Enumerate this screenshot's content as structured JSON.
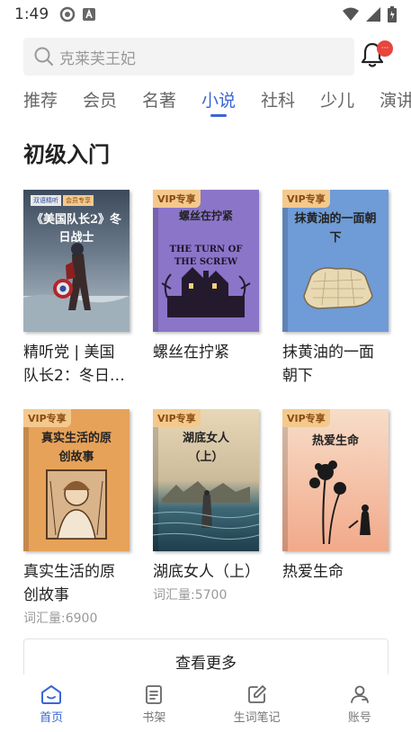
{
  "status_bar": {
    "time": "1:49"
  },
  "search": {
    "placeholder": "克莱芙王妃"
  },
  "notifications": {
    "badge": "···"
  },
  "tabs": [
    {
      "label": "推荐"
    },
    {
      "label": "会员"
    },
    {
      "label": "名著"
    },
    {
      "label": "小说"
    },
    {
      "label": "社科"
    },
    {
      "label": "少儿"
    },
    {
      "label": "演讲"
    }
  ],
  "active_tab": "小说",
  "section": {
    "title": "初级入门"
  },
  "books": [
    {
      "title": "精听党 | 美国队长2：冬日…",
      "vip": "",
      "cover_title": "《美国队长2》冬日战士",
      "cover_tag1": "双语精听",
      "cover_tag2": "会员专享",
      "meta": ""
    },
    {
      "title": "螺丝在拧紧",
      "vip": "VIP专享",
      "cover_title": "螺丝在拧紧",
      "cover_sub": "THE TURN OF THE SCREW",
      "meta": ""
    },
    {
      "title": "抹黄油的一面朝下",
      "vip": "VIP专享",
      "cover_title": "抹黄油的一面朝下",
      "meta": ""
    },
    {
      "title": "真实生活的原创故事",
      "vip": "VIP专享",
      "cover_title": "真实生活的原创故事",
      "meta": "词汇量:6900"
    },
    {
      "title": "湖底女人（上）",
      "vip": "VIP专享",
      "cover_title": "湖底女人（上）",
      "meta": "词汇量:5700"
    },
    {
      "title": "热爱生命",
      "vip": "VIP专享",
      "cover_title": "热爱生命",
      "meta": ""
    }
  ],
  "more_button": {
    "label": "查看更多"
  },
  "bottom_nav": [
    {
      "label": "首页",
      "icon": "home-icon"
    },
    {
      "label": "书架",
      "icon": "bookshelf-icon"
    },
    {
      "label": "生词笔记",
      "icon": "notes-icon"
    },
    {
      "label": "账号",
      "icon": "account-icon"
    }
  ],
  "colors": {
    "accent": "#3a66d6",
    "vip_bg": "#f3c98e",
    "badge": "#e8453c"
  }
}
